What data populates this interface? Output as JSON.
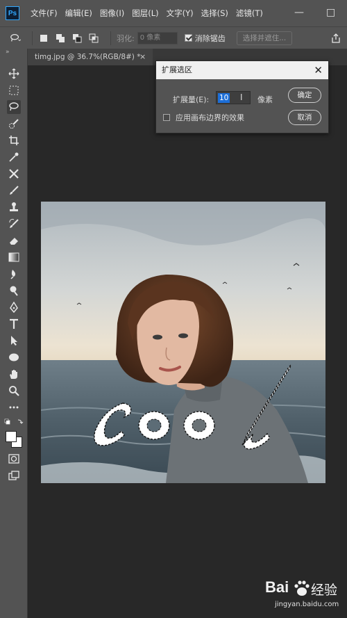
{
  "menubar": {
    "logo": "Ps",
    "items": [
      "文件(F)",
      "编辑(E)",
      "图像(I)",
      "图层(L)",
      "文字(Y)",
      "选择(S)",
      "滤镜(T)"
    ],
    "minimize": "—",
    "restore": "□"
  },
  "options": {
    "feather_label": "羽化:",
    "feather_value": "0 像素",
    "antialias_label": "消除锯齿",
    "select_mask_label": "选择并遮住..."
  },
  "tab": {
    "title": "timg.jpg @ 36.7%(RGB/8#) *",
    "close": "×"
  },
  "dialog": {
    "title": "扩展选区",
    "close": "✕",
    "expand_label": "扩展量(E):",
    "expand_value": "10",
    "unit": "像素",
    "ok": "确定",
    "cancel": "取消",
    "canvas_bounds_label": "应用画布边界的效果"
  },
  "image": {
    "overlay_text": "cool"
  },
  "watermark": {
    "brand": "Bai",
    "brand2": "经验",
    "url": "jingyan.baidu.com"
  },
  "colors": {
    "ui_panel": "#535353",
    "canvas_bg": "#282828",
    "accent_blue": "#1c6ed8"
  }
}
